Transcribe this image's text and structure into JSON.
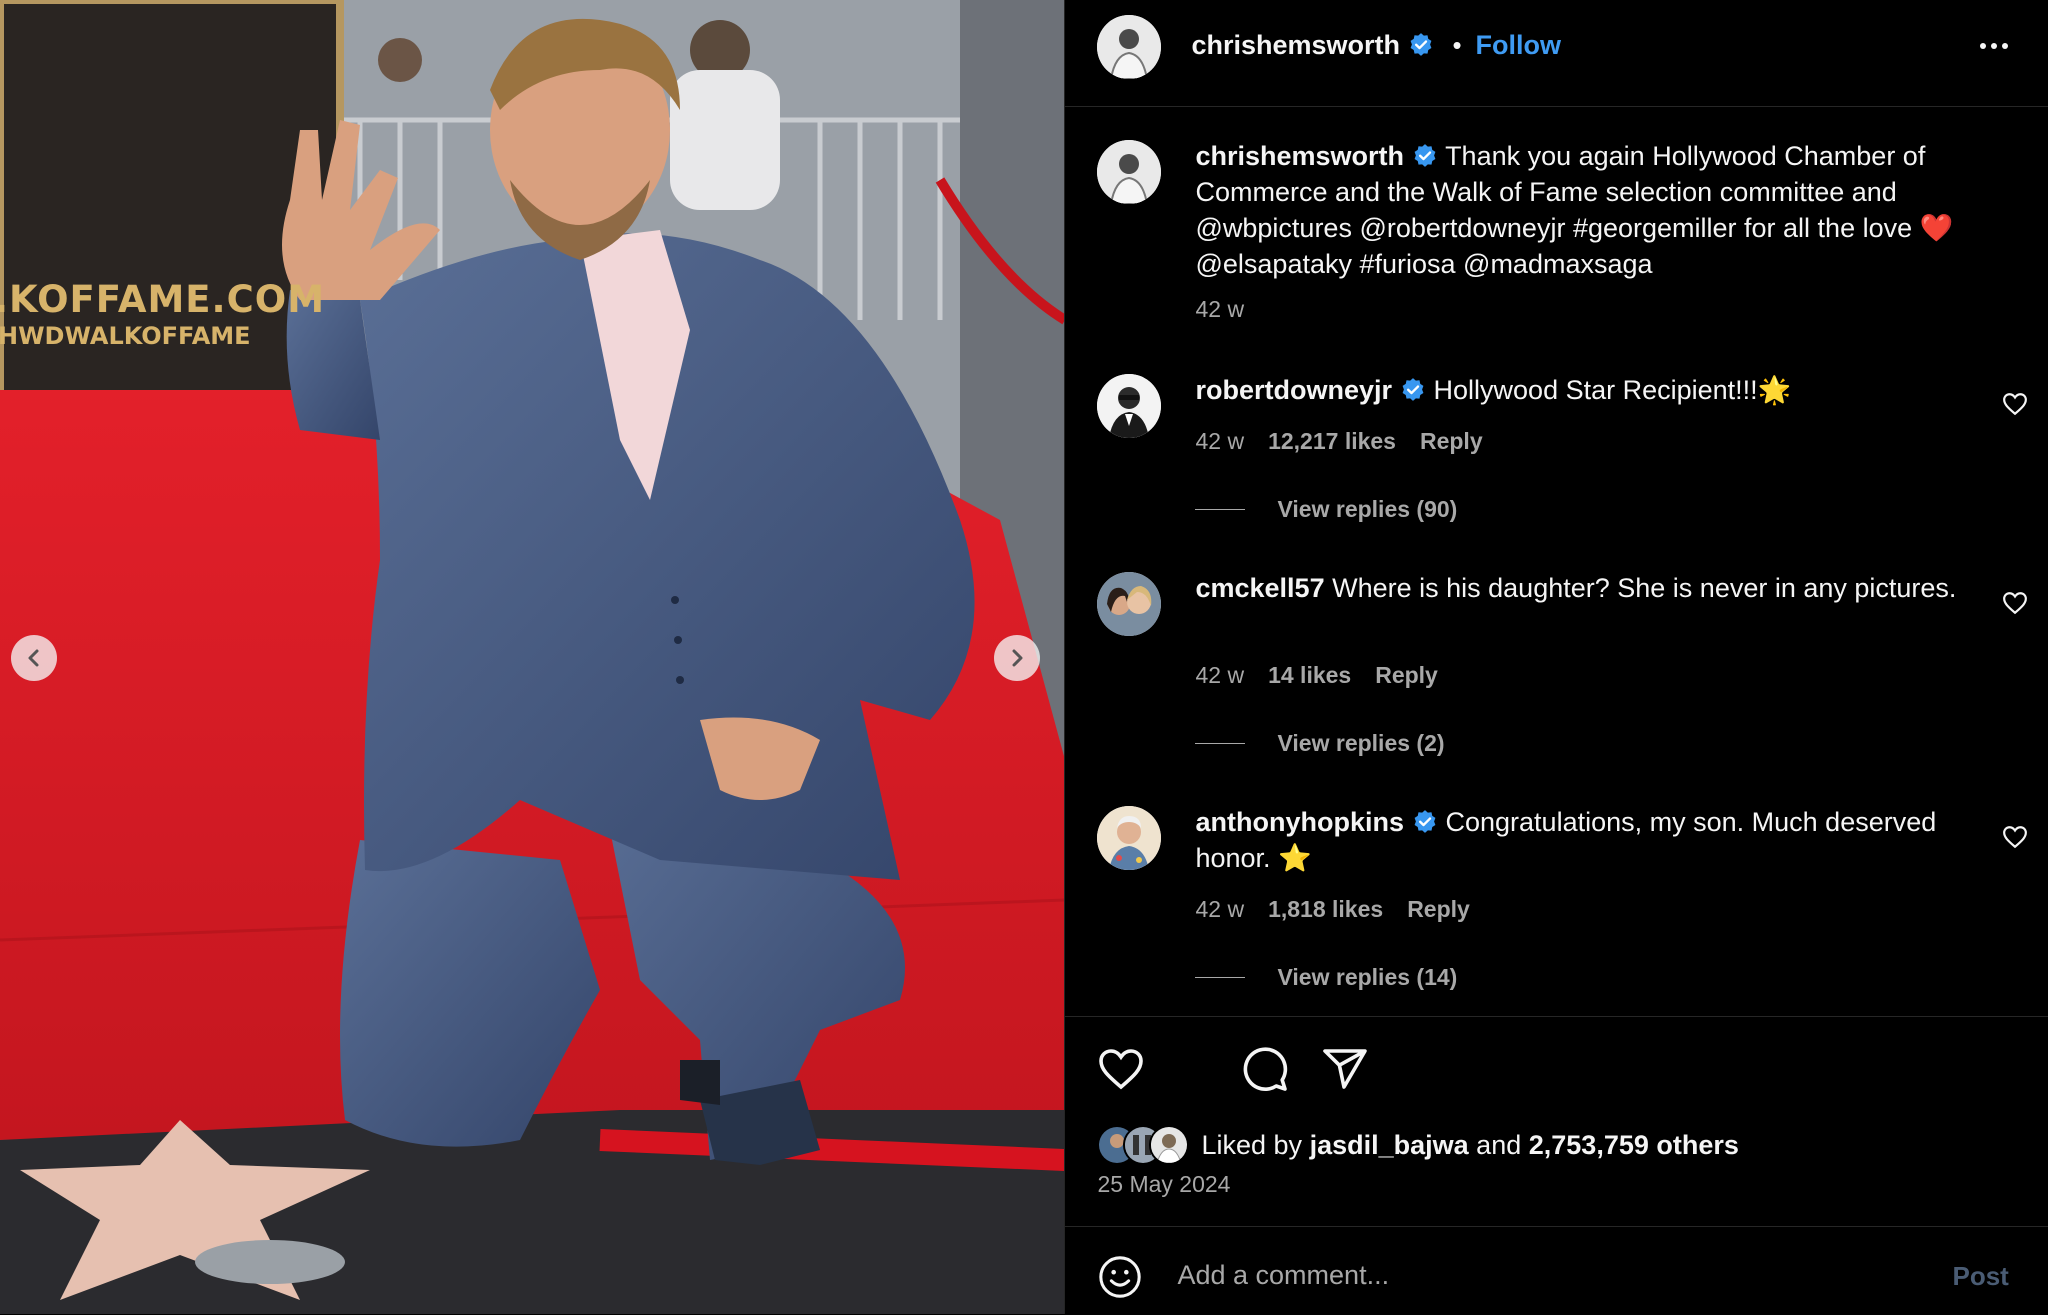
{
  "header": {
    "username": "chrishemsworth",
    "separator": "•",
    "follow_label": "Follow"
  },
  "caption": {
    "username": "chrishemsworth",
    "text": "Thank you again Hollywood Chamber of Commerce and the Walk of Fame selection committee and @wbpictures @robertdowneyjr #georgemiller for all the love ❤️ @elsapataky #furiosa @madmaxsaga",
    "time": "42 w"
  },
  "comments": [
    {
      "username": "robertdowneyjr",
      "verified": true,
      "text": "Hollywood Star Recipient!!!🌟",
      "time": "42 w",
      "likes": "12,217 likes",
      "reply_label": "Reply",
      "view_replies": "View replies (90)"
    },
    {
      "username": "cmckell57",
      "verified": false,
      "text": "Where is his daughter? She is never in any pictures.",
      "time": "42 w",
      "likes": "14 likes",
      "reply_label": "Reply",
      "view_replies": "View replies (2)"
    },
    {
      "username": "anthonyhopkins",
      "verified": true,
      "text": "Congratulations, my son. Much deserved honor. ⭐",
      "time": "42 w",
      "likes": "1,818 likes",
      "reply_label": "Reply",
      "view_replies": "View replies (14)"
    }
  ],
  "liked_by": {
    "prefix": "Liked by",
    "user": "jasdil_bajwa",
    "and": "and",
    "others": "2,753,759 others"
  },
  "post_date": "25 May 2024",
  "comment_box": {
    "placeholder": "Add a comment...",
    "post_label": "Post"
  },
  "photo": {
    "sign_line1": ".KOFFAME.COM",
    "sign_line2": "HWDWALKOFFAME"
  },
  "icons": {
    "verified": "verified-badge-icon",
    "heart": "heart-icon",
    "comment": "comment-icon",
    "share": "share-icon",
    "save": "bookmark-icon",
    "more": "more-icon",
    "emoji": "emoji-icon"
  },
  "colors": {
    "background": "#000000",
    "link_blue": "#3f9bf3",
    "muted_text": "#a8a8a8",
    "verified_blue": "#3897f0",
    "post_button_disabled": "#4a5c74"
  }
}
